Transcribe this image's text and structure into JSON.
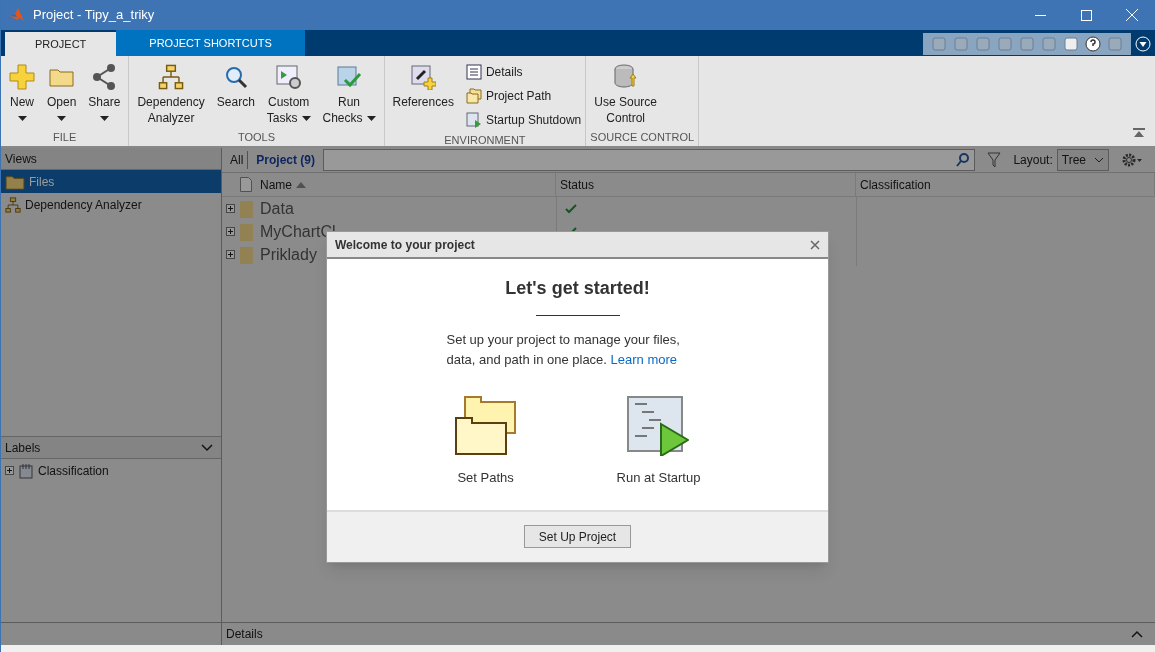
{
  "window": {
    "title": "Project - Tipy_a_triky"
  },
  "ribbon": {
    "tabs": [
      {
        "label": "PROJECT",
        "selected": true
      },
      {
        "label": "PROJECT SHORTCUTS",
        "selected": false
      }
    ],
    "groups": [
      {
        "title": "FILE",
        "items": [
          {
            "kind": "large",
            "lines": [
              "New"
            ],
            "dropdown": true
          },
          {
            "kind": "large",
            "lines": [
              "Open"
            ],
            "dropdown": true
          },
          {
            "kind": "large",
            "lines": [
              "Share"
            ],
            "dropdown": true
          }
        ]
      },
      {
        "title": "TOOLS",
        "items": [
          {
            "kind": "large",
            "lines": [
              "Dependency",
              "Analyzer"
            ],
            "dropdown": false
          },
          {
            "kind": "large",
            "lines": [
              "Search"
            ],
            "dropdown": false
          },
          {
            "kind": "large",
            "lines": [
              "Custom",
              "Tasks"
            ],
            "dropdown": true
          },
          {
            "kind": "large",
            "lines": [
              "Run",
              "Checks"
            ],
            "dropdown": true
          }
        ]
      },
      {
        "title": "ENVIRONMENT",
        "items": [
          {
            "kind": "large",
            "lines": [
              "References"
            ],
            "dropdown": false
          },
          {
            "kind": "small",
            "lines": [
              "Details"
            ],
            "dropdown": false
          },
          {
            "kind": "small",
            "lines": [
              "Project Path"
            ],
            "dropdown": false
          },
          {
            "kind": "small",
            "lines": [
              "Startup Shutdown"
            ],
            "dropdown": false
          }
        ]
      },
      {
        "title": "SOURCE CONTROL",
        "items": [
          {
            "kind": "large",
            "lines": [
              "Use Source",
              "Control"
            ],
            "dropdown": false
          }
        ]
      }
    ]
  },
  "views": {
    "header": "Views",
    "items": [
      {
        "label": "Files",
        "selected": true
      },
      {
        "label": "Dependency Analyzer",
        "selected": false
      }
    ]
  },
  "labels": {
    "header": "Labels",
    "items": [
      {
        "label": "Classification",
        "expanded": false
      }
    ]
  },
  "filter": {
    "tabs": [
      {
        "label": "All",
        "selected": false
      },
      {
        "label": "Project (9)",
        "selected": true
      }
    ],
    "layout_label": "Layout:",
    "layout_value": "Tree"
  },
  "table": {
    "columns": [
      {
        "label": "Name",
        "sorted": true
      },
      {
        "label": "Status",
        "sorted": false
      },
      {
        "label": "Classification",
        "sorted": false
      }
    ],
    "rows": [
      {
        "name": "Data",
        "ok": true
      },
      {
        "name": "MyChartCl",
        "ok": true
      },
      {
        "name": "Priklady",
        "ok": false
      }
    ]
  },
  "details_bar": {
    "label": "Details"
  },
  "dialog": {
    "title": "Welcome to your project",
    "heading": "Let's get started!",
    "text": "Set up your project to manage your files, data, and path in one place.",
    "link": "Learn more",
    "actions": [
      {
        "kind": "paths",
        "label": "Set Paths"
      },
      {
        "kind": "startup",
        "label": "Run at Startup"
      }
    ],
    "button": "Set Up Project"
  }
}
